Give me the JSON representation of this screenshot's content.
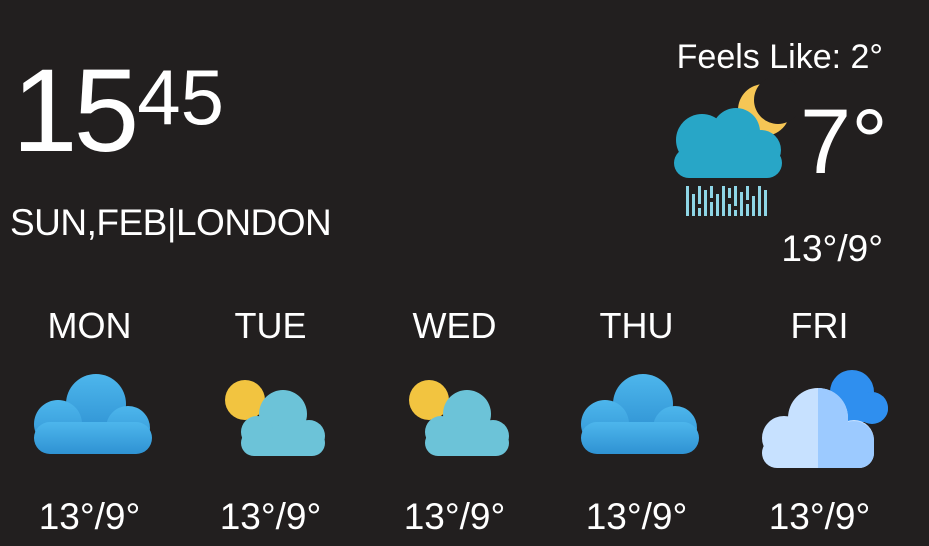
{
  "clock": {
    "hours": "15",
    "minutes": "45"
  },
  "date_location": "SUN,FEB|LONDON",
  "current": {
    "feels_like": "Feels Like: 2°",
    "temperature": "7°",
    "range": "13°/9°",
    "icon": "night-rain-cloud-icon"
  },
  "forecast": [
    {
      "day": "MON",
      "range": "13°/9°",
      "icon": "cloud-icon"
    },
    {
      "day": "TUE",
      "range": "13°/9°",
      "icon": "partly-sunny-icon"
    },
    {
      "day": "WED",
      "range": "13°/9°",
      "icon": "partly-sunny-icon"
    },
    {
      "day": "THU",
      "range": "13°/9°",
      "icon": "cloud-icon"
    },
    {
      "day": "FRI",
      "range": "13°/9°",
      "icon": "overcast-clouds-icon"
    }
  ],
  "colors": {
    "background": "#221f1f",
    "cloud_blue": "#3ea5e2",
    "cloud_teal": "#6cc3d8",
    "sun_yellow": "#f2c440",
    "moon_yellow": "#f6c655",
    "rain": "#8fd6e6",
    "overcast_front": "#c7e1ff",
    "overcast_back": "#2f8fef"
  }
}
